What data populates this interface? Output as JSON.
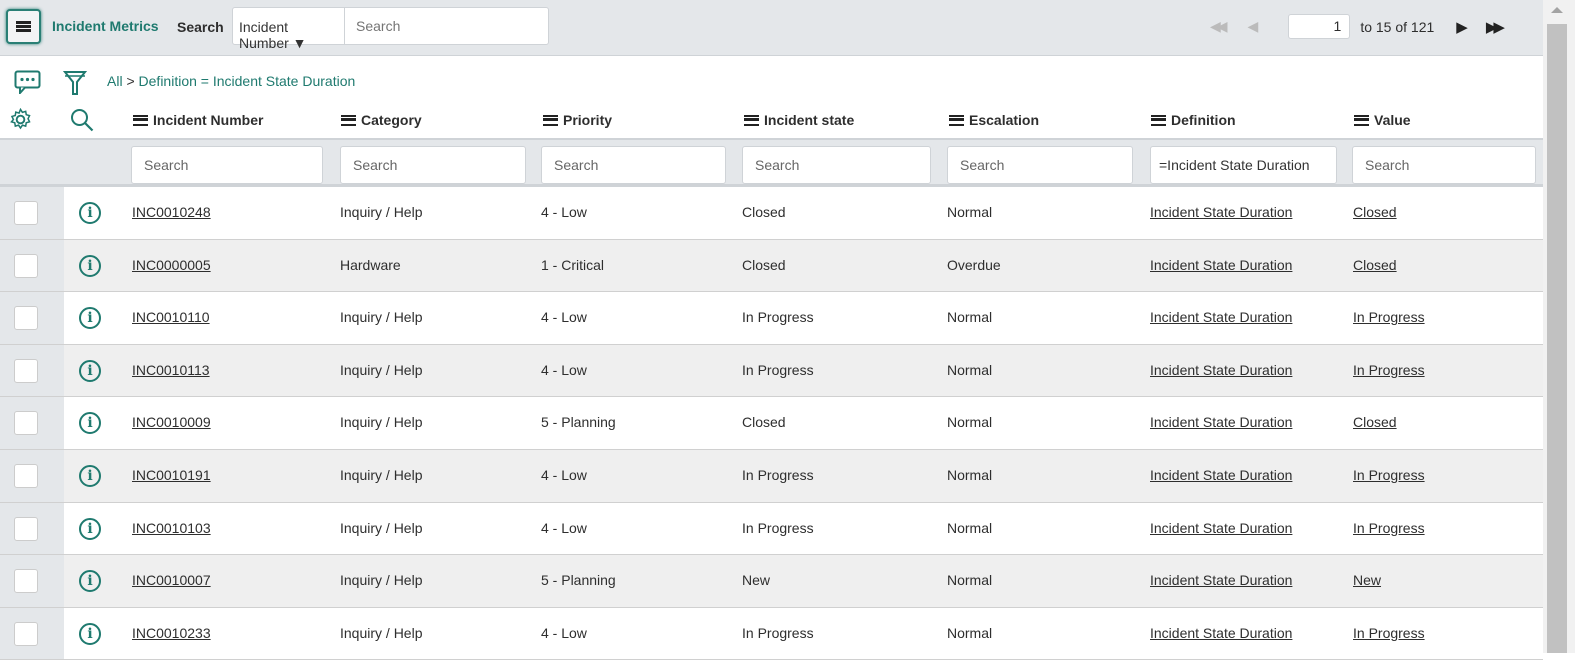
{
  "header": {
    "title": "Incident Metrics",
    "search_label": "Search",
    "search_field": "Incident Number",
    "search_placeholder": "Search"
  },
  "pager": {
    "first": "◀◀",
    "prev": "◀",
    "page": "1",
    "range": "to 15 of 121",
    "next": "▶",
    "last": "▶▶"
  },
  "breadcrumb": {
    "all": "All",
    "sep": ">",
    "filter": "Definition = Incident State Duration"
  },
  "columns": [
    "Incident Number",
    "Category",
    "Priority",
    "Incident state",
    "Escalation",
    "Definition",
    "Value"
  ],
  "filters": {
    "placeholder": "Search",
    "definition_value": "=Incident State Duration"
  },
  "rows": [
    [
      "INC0010248",
      "Inquiry / Help",
      "4 - Low",
      "Closed",
      "Normal",
      "Incident State Duration",
      "Closed"
    ],
    [
      "INC0000005",
      "Hardware",
      "1 - Critical",
      "Closed",
      "Overdue",
      "Incident State Duration",
      "Closed"
    ],
    [
      "INC0010110",
      "Inquiry / Help",
      "4 - Low",
      "In Progress",
      "Normal",
      "Incident State Duration",
      "In Progress"
    ],
    [
      "INC0010113",
      "Inquiry / Help",
      "4 - Low",
      "In Progress",
      "Normal",
      "Incident State Duration",
      "In Progress"
    ],
    [
      "INC0010009",
      "Inquiry / Help",
      "5 - Planning",
      "Closed",
      "Normal",
      "Incident State Duration",
      "Closed"
    ],
    [
      "INC0010191",
      "Inquiry / Help",
      "4 - Low",
      "In Progress",
      "Normal",
      "Incident State Duration",
      "In Progress"
    ],
    [
      "INC0010103",
      "Inquiry / Help",
      "4 - Low",
      "In Progress",
      "Normal",
      "Incident State Duration",
      "In Progress"
    ],
    [
      "INC0010007",
      "Inquiry / Help",
      "5 - Planning",
      "New",
      "Normal",
      "Incident State Duration",
      "New"
    ],
    [
      "INC0010233",
      "Inquiry / Help",
      "4 - Low",
      "In Progress",
      "Normal",
      "Incident State Duration",
      "In Progress"
    ]
  ],
  "colors": {
    "accent": "#1f7a6f",
    "toolbar": "#e4e7ea"
  }
}
